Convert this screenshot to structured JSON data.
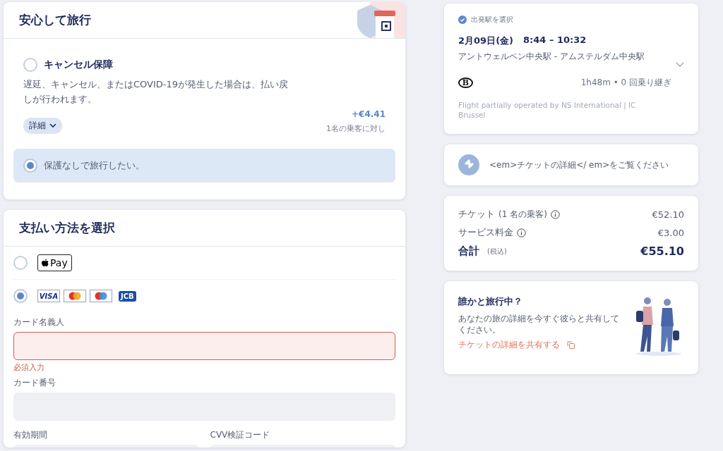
{
  "protection": {
    "title": "安心して旅行",
    "options": [
      {
        "kind": "insurance",
        "label": "キャンセル保障",
        "description": "遅延、キャンセル、またはCOVID-19が発生した場合は、払い戻しが行われます。",
        "price": "+€4.41",
        "price_note": "1名の乗客に対し",
        "details_button": "詳細",
        "selected": false
      },
      {
        "kind": "none",
        "label": "保護なしで旅行したい。",
        "selected": true
      }
    ]
  },
  "payment": {
    "title": "支払い方法を選択",
    "methods": [
      {
        "kind": "applepay",
        "mark_text": "Pay",
        "selected": false
      },
      {
        "kind": "cards",
        "logos": [
          {
            "kind": "visa",
            "text": "VISA"
          },
          {
            "kind": "mastercard"
          },
          {
            "kind": "maestro"
          },
          {
            "kind": "jcb",
            "text": "JCB"
          }
        ],
        "selected": true
      }
    ],
    "fields": [
      {
        "label": "カード名義人",
        "invalid": true,
        "error": "必須入力"
      },
      {
        "label": "カード番号",
        "invalid": false
      }
    ],
    "split_fields": [
      {
        "label": "有効期間"
      },
      {
        "label": "CVV検証コード"
      }
    ]
  },
  "journey": {
    "step_label": "出発駅を選択",
    "date": "2月09日(金)",
    "times": "8:44 – 10:32",
    "route": "アントウェルペン中央駅 - アムステルダム中央駅",
    "operator_logo": "B",
    "duration": "1h48m • 0 回乗り継ぎ",
    "operator_note": "Flight partially operated by NS International | IC Brussel"
  },
  "ticket_notice": "<em>チケットの詳細</ em>をご覧ください",
  "price_summary": {
    "rows": [
      {
        "label": "チケット",
        "note": "(1 名の乗客)",
        "amount": "€52.10"
      },
      {
        "label": "サービス料金",
        "amount": "€3.00"
      }
    ],
    "total": {
      "label": "合計",
      "note": "(税込)",
      "amount": "€55.10"
    }
  },
  "share": {
    "title": "誰かと旅行中？",
    "text": "あなたの旅の詳細を今すぐ彼らと共有してください。",
    "link": "チケットの詳細を共有する"
  }
}
